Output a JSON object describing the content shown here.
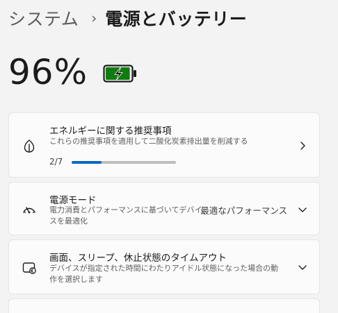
{
  "breadcrumb": {
    "parent": "システム",
    "separator": "›",
    "current": "電源とバッテリー"
  },
  "battery": {
    "percent": "96%",
    "level": 0.96,
    "icon": "battery-charging-icon",
    "color": "#107c10"
  },
  "cards": {
    "recommendations": {
      "title": "エネルギーに関する推奨事項",
      "description": "これらの推奨事項を適用して二酸化炭素排出量を削減する",
      "progress_label": "2/7",
      "progress": 0.2857,
      "icon": "leaf-icon"
    },
    "power_mode": {
      "title": "電源モード",
      "description": "電力消費とパフォーマンスに基づいてデバイスを最適化",
      "value": "最適なパフォーマンス",
      "icon": "power-mode-icon"
    },
    "sleep": {
      "title": "画面、スリープ、休止状態のタイムアウト",
      "description": "デバイスが指定された時間にわたりアイドル状態になった場合の動作を選択します",
      "icon": "sleep-timeout-icon"
    }
  },
  "colors": {
    "accent": "#0a67c0",
    "background": "#f3f3f3",
    "card": "#fbfbfb"
  }
}
